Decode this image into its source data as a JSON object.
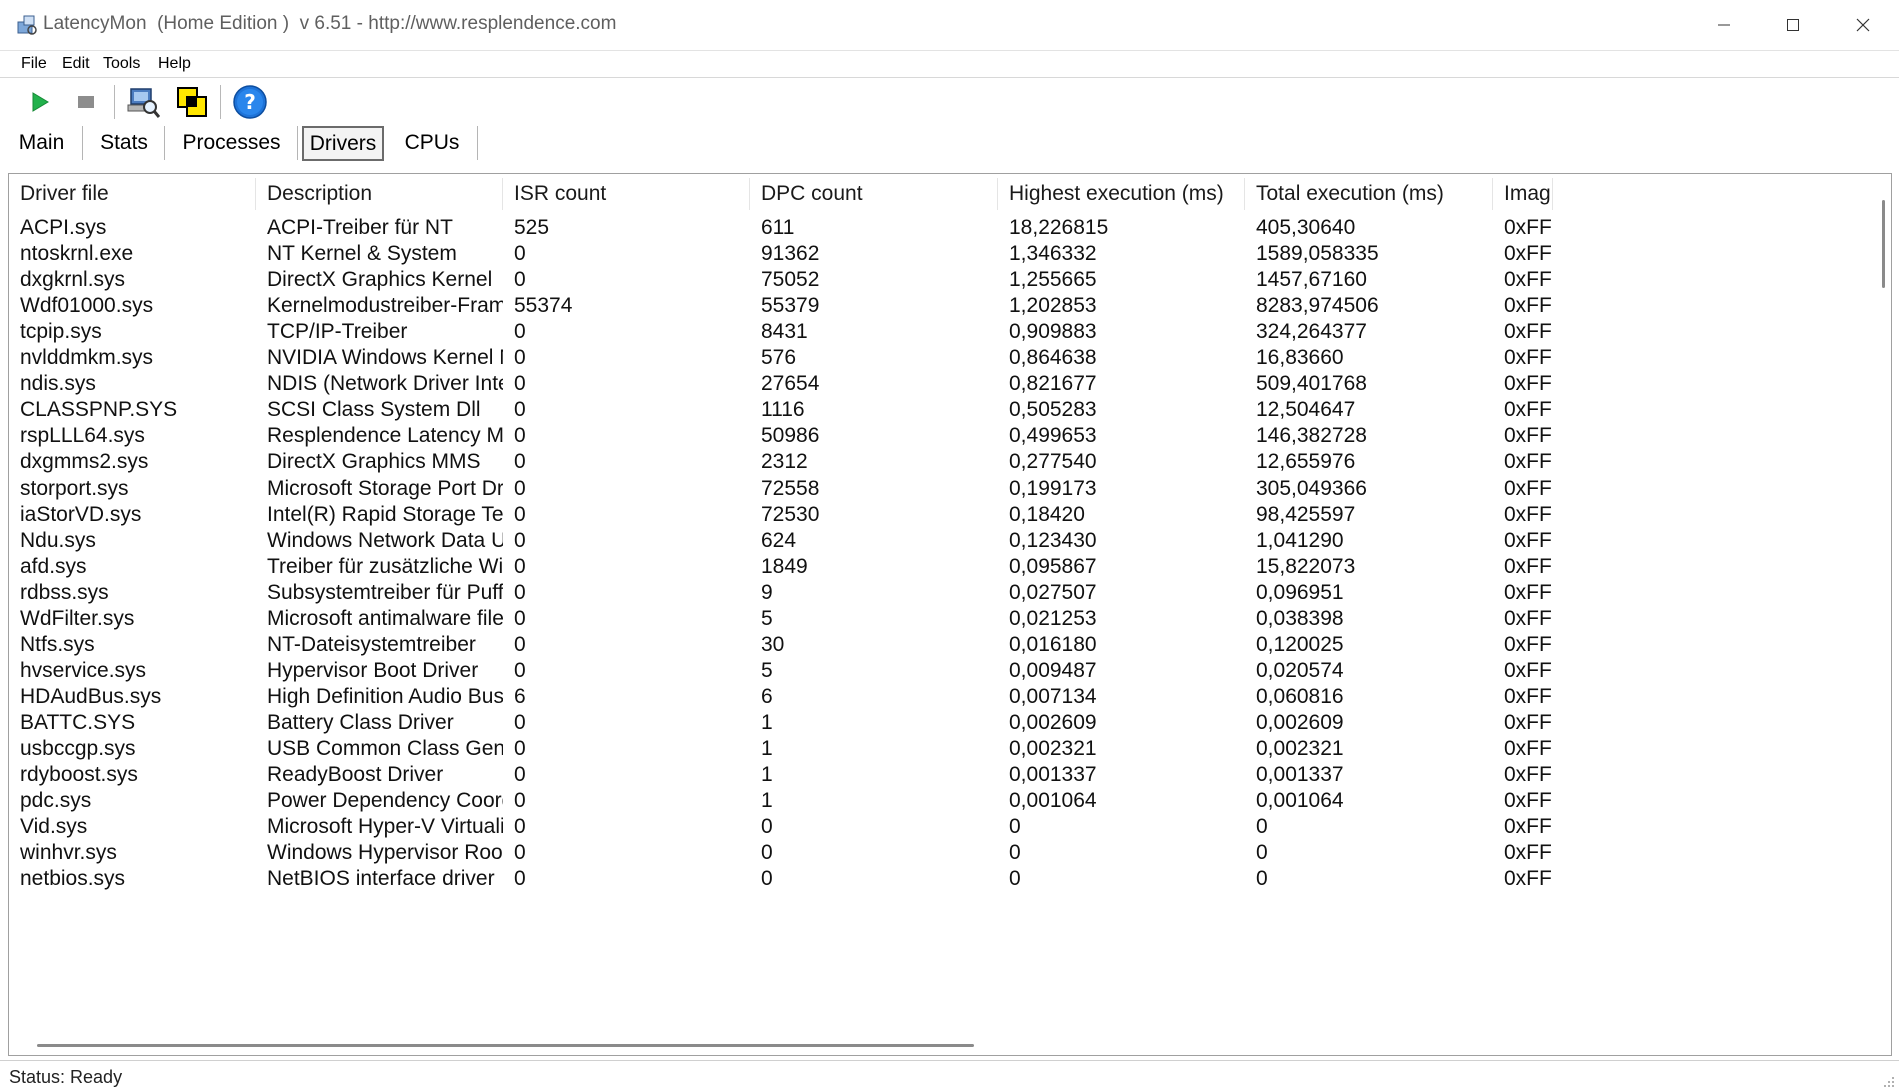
{
  "window": {
    "title": "LatencyMon  (Home Edition )  v 6.51 - http://www.resplendence.com"
  },
  "menu": [
    "File",
    "Edit",
    "Tools",
    "Help"
  ],
  "toolbar": {
    "icons": [
      "play-icon",
      "stop-icon",
      "computer-search-icon",
      "windows-icon",
      "help-icon"
    ],
    "play_color": "#22b14c",
    "help_color": "#1e73d8"
  },
  "tabs": {
    "items": [
      "Main",
      "Stats",
      "Processes",
      "Drivers",
      "CPUs"
    ],
    "active": "Drivers"
  },
  "table": {
    "columns": [
      "Driver file",
      "Description",
      "ISR count",
      "DPC count",
      "Highest execution (ms)",
      "Total execution (ms)",
      "Imag"
    ],
    "rows": [
      [
        "ACPI.sys",
        "ACPI-Treiber für NT",
        "525",
        "611",
        "18,226815",
        "405,30640",
        "0xFF"
      ],
      [
        "ntoskrnl.exe",
        "NT Kernel & System",
        "0",
        "91362",
        "1,346332",
        "1589,058335",
        "0xFF"
      ],
      [
        "dxgkrnl.sys",
        "DirectX Graphics Kernel",
        "0",
        "75052",
        "1,255665",
        "1457,67160",
        "0xFF"
      ],
      [
        "Wdf01000.sys",
        "Kernelmodustreiber-Framew...",
        "55374",
        "55379",
        "1,202853",
        "8283,974506",
        "0xFF"
      ],
      [
        "tcpip.sys",
        "TCP/IP-Treiber",
        "0",
        "8431",
        "0,909883",
        "324,264377",
        "0xFF"
      ],
      [
        "nvlddmkm.sys",
        "NVIDIA Windows Kernel Mod...",
        "0",
        "576",
        "0,864638",
        "16,83660",
        "0xFF"
      ],
      [
        "ndis.sys",
        "NDIS (Network Driver Interf...",
        "0",
        "27654",
        "0,821677",
        "509,401768",
        "0xFF"
      ],
      [
        "CLASSPNP.SYS",
        "SCSI Class System Dll",
        "0",
        "1116",
        "0,505283",
        "12,504647",
        "0xFF"
      ],
      [
        "rspLLL64.sys",
        "Resplendence Latency Monit...",
        "0",
        "50986",
        "0,499653",
        "146,382728",
        "0xFF"
      ],
      [
        "dxgmms2.sys",
        "DirectX Graphics MMS",
        "0",
        "2312",
        "0,277540",
        "12,655976",
        "0xFF"
      ],
      [
        "storport.sys",
        "Microsoft Storage Port Driver",
        "0",
        "72558",
        "0,199173",
        "305,049366",
        "0xFF"
      ],
      [
        "iaStorVD.sys",
        "Intel(R) Rapid Storage Tech...",
        "0",
        "72530",
        "0,18420",
        "98,425597",
        "0xFF"
      ],
      [
        "Ndu.sys",
        "Windows Network Data Usa...",
        "0",
        "624",
        "0,123430",
        "1,041290",
        "0xFF"
      ],
      [
        "afd.sys",
        "Treiber für zusätzliche WinS...",
        "0",
        "1849",
        "0,095867",
        "15,822073",
        "0xFF"
      ],
      [
        "rdbss.sys",
        "Subsystemtreiber für Puffer...",
        "0",
        "9",
        "0,027507",
        "0,096951",
        "0xFF"
      ],
      [
        "WdFilter.sys",
        "Microsoft antimalware file sys...",
        "0",
        "5",
        "0,021253",
        "0,038398",
        "0xFF"
      ],
      [
        "Ntfs.sys",
        "NT-Dateisystemtreiber",
        "0",
        "30",
        "0,016180",
        "0,120025",
        "0xFF"
      ],
      [
        "hvservice.sys",
        "Hypervisor Boot Driver",
        "0",
        "5",
        "0,009487",
        "0,020574",
        "0xFF"
      ],
      [
        "HDAudBus.sys",
        "High Definition Audio Bus Dri...",
        "6",
        "6",
        "0,007134",
        "0,060816",
        "0xFF"
      ],
      [
        "BATTC.SYS",
        "Battery Class Driver",
        "0",
        "1",
        "0,002609",
        "0,002609",
        "0xFF"
      ],
      [
        "usbccgp.sys",
        "USB Common Class Generic ...",
        "0",
        "1",
        "0,002321",
        "0,002321",
        "0xFF"
      ],
      [
        "rdyboost.sys",
        "ReadyBoost Driver",
        "0",
        "1",
        "0,001337",
        "0,001337",
        "0xFF"
      ],
      [
        "pdc.sys",
        "Power Dependency Coordin...",
        "0",
        "1",
        "0,001064",
        "0,001064",
        "0xFF"
      ],
      [
        "Vid.sys",
        "Microsoft Hyper-V Virtualizati...",
        "0",
        "0",
        "0",
        "0",
        "0xFF"
      ],
      [
        "winhvr.sys",
        "Windows Hypervisor Root I...",
        "0",
        "0",
        "0",
        "0",
        "0xFF"
      ],
      [
        "netbios.sys",
        "NetBIOS interface driver",
        "0",
        "0",
        "0",
        "0",
        "0xFF"
      ]
    ]
  },
  "status": {
    "text": "Status: Ready"
  }
}
